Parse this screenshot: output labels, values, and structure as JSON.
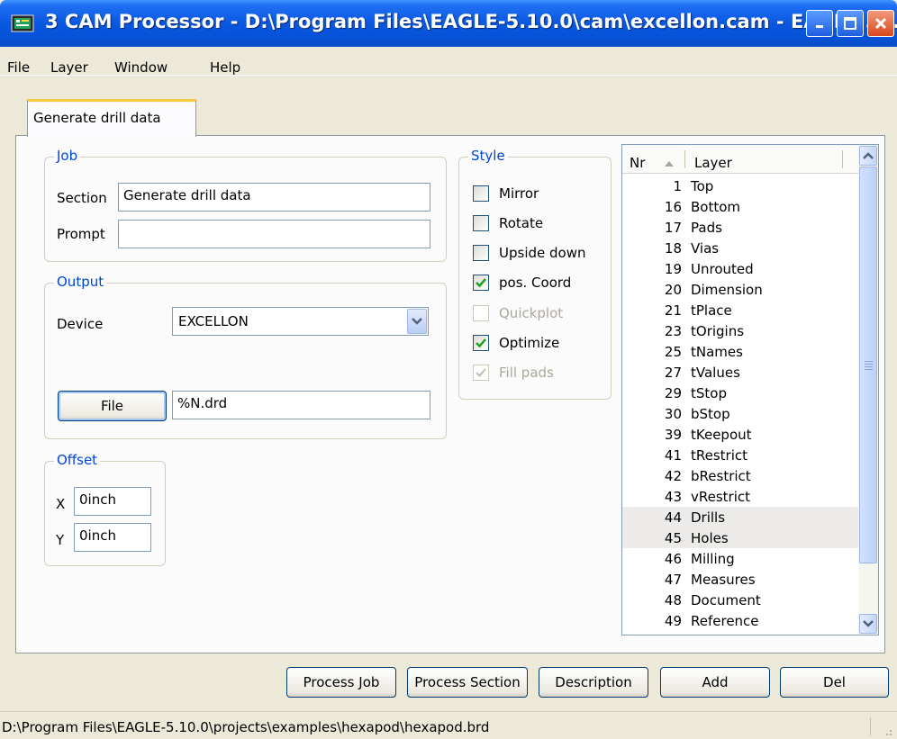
{
  "window": {
    "title": "3 CAM Processor - D:\\Program Files\\EAGLE-5.10.0\\cam\\excellon.cam - EAGLE 5..."
  },
  "menu": [
    "File",
    "Layer",
    "Window",
    "Help"
  ],
  "tab": {
    "label": "Generate drill data"
  },
  "job": {
    "group_label": "Job",
    "section_label": "Section",
    "section_value": "Generate drill data",
    "prompt_label": "Prompt",
    "prompt_value": ""
  },
  "output": {
    "group_label": "Output",
    "device_label": "Device",
    "device_value": "EXCELLON",
    "file_button": "File",
    "file_value": "%N.drd"
  },
  "offset": {
    "group_label": "Offset",
    "x_label": "X",
    "x_value": "0inch",
    "y_label": "Y",
    "y_value": "0inch"
  },
  "style": {
    "group_label": "Style",
    "options": [
      {
        "label": "Mirror",
        "checked": false,
        "enabled": true
      },
      {
        "label": "Rotate",
        "checked": false,
        "enabled": true
      },
      {
        "label": "Upside down",
        "checked": false,
        "enabled": true
      },
      {
        "label": "pos. Coord",
        "checked": true,
        "enabled": true
      },
      {
        "label": "Quickplot",
        "checked": false,
        "enabled": false
      },
      {
        "label": "Optimize",
        "checked": true,
        "enabled": true
      },
      {
        "label": "Fill pads",
        "checked": true,
        "enabled": false
      }
    ]
  },
  "layers": {
    "header_nr": "Nr",
    "header_layer": "Layer",
    "rows": [
      {
        "nr": "1",
        "name": "Top",
        "selected": false
      },
      {
        "nr": "16",
        "name": "Bottom",
        "selected": false
      },
      {
        "nr": "17",
        "name": "Pads",
        "selected": false
      },
      {
        "nr": "18",
        "name": "Vias",
        "selected": false
      },
      {
        "nr": "19",
        "name": "Unrouted",
        "selected": false
      },
      {
        "nr": "20",
        "name": "Dimension",
        "selected": false
      },
      {
        "nr": "21",
        "name": "tPlace",
        "selected": false
      },
      {
        "nr": "23",
        "name": "tOrigins",
        "selected": false
      },
      {
        "nr": "25",
        "name": "tNames",
        "selected": false
      },
      {
        "nr": "27",
        "name": "tValues",
        "selected": false
      },
      {
        "nr": "29",
        "name": "tStop",
        "selected": false
      },
      {
        "nr": "30",
        "name": "bStop",
        "selected": false
      },
      {
        "nr": "39",
        "name": "tKeepout",
        "selected": false
      },
      {
        "nr": "41",
        "name": "tRestrict",
        "selected": false
      },
      {
        "nr": "42",
        "name": "bRestrict",
        "selected": false
      },
      {
        "nr": "43",
        "name": "vRestrict",
        "selected": false
      },
      {
        "nr": "44",
        "name": "Drills",
        "selected": true
      },
      {
        "nr": "45",
        "name": "Holes",
        "selected": true
      },
      {
        "nr": "46",
        "name": "Milling",
        "selected": false
      },
      {
        "nr": "47",
        "name": "Measures",
        "selected": false
      },
      {
        "nr": "48",
        "name": "Document",
        "selected": false
      },
      {
        "nr": "49",
        "name": "Reference",
        "selected": false
      }
    ]
  },
  "buttons": {
    "process_job": "Process Job",
    "process_section": "Process Section",
    "description": "Description",
    "add": "Add",
    "del": "Del"
  },
  "status": {
    "text": "D:\\Program Files\\EAGLE-5.10.0\\projects\\examples\\hexapod\\hexapod.brd"
  }
}
